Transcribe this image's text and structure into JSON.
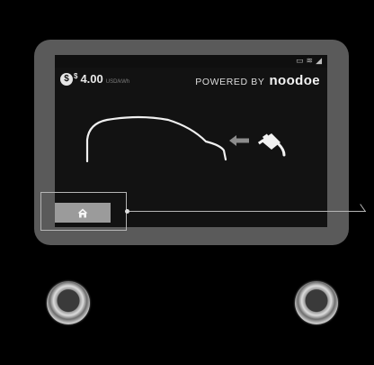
{
  "status_bar": {
    "icons": [
      "screen-cast-icon",
      "wifi-icon",
      "signal-icon"
    ],
    "glyphs": [
      "▭",
      "≋",
      "◢"
    ]
  },
  "price": {
    "currency_icon": "dollar-coin-icon",
    "coin_glyph": "$",
    "currency_symbol": "$",
    "value": "4.00",
    "unit": "USD/kWh"
  },
  "branding": {
    "powered_by_label": "POWERED BY",
    "brand_name": "noodoe"
  },
  "illustration": {
    "car_icon": "car-outline-icon",
    "arrow_icon": "arrow-left-icon",
    "plug_icon": "ev-plug-icon"
  },
  "home_button": {
    "icon": "home-icon"
  },
  "hardware": {
    "left_button": "physical-button-left",
    "right_button": "physical-button-right"
  },
  "colors": {
    "bezel": "#5a5a5a",
    "screen_bg": "#121212",
    "home_button_bg": "#9b9b9b",
    "highlight": "#b5b5b5"
  }
}
